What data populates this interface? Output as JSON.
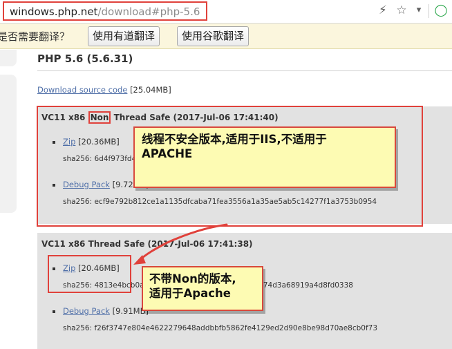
{
  "browser": {
    "url_host": "windows.php.net",
    "url_path": "/download#php-5.6",
    "icons": [
      "lightning-icon",
      "star-icon",
      "chevron-down-icon",
      "extension-icon"
    ]
  },
  "translate_bar": {
    "prompt": "是否需要翻译？",
    "youdao_button": "使用有道翻译",
    "google_button": "使用谷歌翻译"
  },
  "page": {
    "title": "PHP 5.6 (5.6.31)",
    "source": {
      "link": "Download source code",
      "size": "[25.04MB]"
    },
    "releases": [
      {
        "title_prefix": "VC11 x86 ",
        "title_non": "Non",
        "title_suffix": " Thread Safe (2017-Jul-06 17:41:40)",
        "items": [
          {
            "link": "Zip",
            "size": "[20.36MB]",
            "sha": "sha256: 6d4f973fd46c4bd0e4bd2b3e6c03d80b437a0cfd1b5e03ac1f5a4d80c7"
          },
          {
            "link": "Debug Pack",
            "size": "[9.72MB]",
            "sha": "sha256: ecf9e792b812ce1a1135dfcaba71fea3556a1a35ae5ab5c14277f1a3753b0954"
          }
        ]
      },
      {
        "title": "VC11 x86 Thread Safe (2017-Jul-06 17:41:38)",
        "items": [
          {
            "link": "Zip",
            "size": "[20.46MB]",
            "sha": "sha256: 4813e4bcb0a4f2cd4b5bb0fcff4d8ea97d8d70a74d3a68919a4d8fd0338"
          },
          {
            "link": "Debug Pack",
            "size": "[9.91MB]",
            "sha": "sha256: f26f3747e804e4622279648addbbfb5862fe4129ed2d90e8be98d70ae8cb0f73"
          }
        ]
      }
    ]
  },
  "annotations": {
    "callout_1_line1": "线程不安全版本,适用于IIS,不适用于",
    "callout_1_line2": "APACHE",
    "callout_2_line1": "不带Non的版本,",
    "callout_2_line2": "适用于Apache"
  },
  "colors": {
    "annotation_red": "#e0413b",
    "callout_fill": "#fdfbb3",
    "link_blue": "#4f6fa8",
    "release_bg": "#e2e2e2",
    "translate_bar_bg": "#fbf6dd"
  }
}
